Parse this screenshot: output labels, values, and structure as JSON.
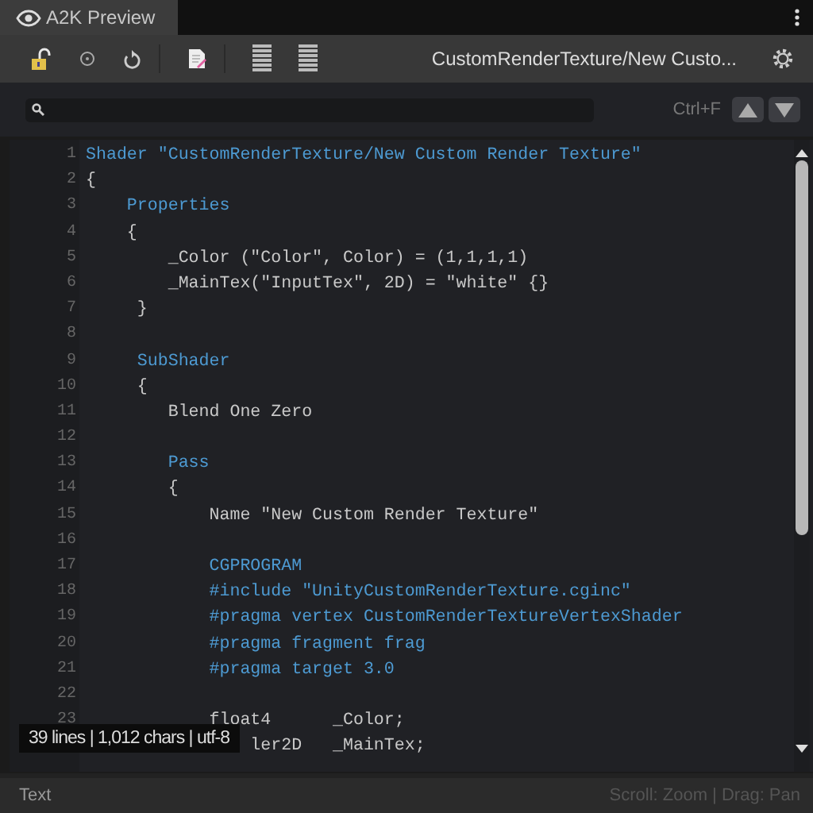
{
  "tab": {
    "label": "A2K Preview",
    "selected": true
  },
  "toolbar": {
    "title": "CustomRenderTexture/New Custo..."
  },
  "search": {
    "shortcut": "Ctrl+F"
  },
  "code": {
    "lines": [
      {
        "number": "1",
        "kind": "keyword",
        "text": "Shader \"CustomRenderTexture/New Custom Render Texture\""
      },
      {
        "number": "2",
        "kind": "plain",
        "text": "{"
      },
      {
        "number": "3",
        "kind": "keyword",
        "text": "    Properties"
      },
      {
        "number": "4",
        "kind": "plain",
        "text": "    {"
      },
      {
        "number": "5",
        "kind": "plain",
        "text": "        _Color (\"Color\", Color) = (1,1,1,1)"
      },
      {
        "number": "6",
        "kind": "plain",
        "text": "        _MainTex(\"InputTex\", 2D) = \"white\" {}"
      },
      {
        "number": "7",
        "kind": "plain",
        "text": "     }"
      },
      {
        "number": "8"
      },
      {
        "number": "9",
        "kind": "keyword",
        "text": "     SubShader"
      },
      {
        "number": "10",
        "kind": "plain",
        "text": "     {"
      },
      {
        "number": "11",
        "kind": "plain",
        "text": "        Blend One Zero"
      },
      {
        "number": "12"
      },
      {
        "number": "13",
        "kind": "keyword",
        "text": "        Pass"
      },
      {
        "number": "14",
        "kind": "plain",
        "text": "        {"
      },
      {
        "number": "15",
        "kind": "plain",
        "text": "            Name \"New Custom Render Texture\""
      },
      {
        "number": "16"
      },
      {
        "number": "17",
        "kind": "keyword",
        "text": "            CGPROGRAM"
      },
      {
        "number": "18",
        "kind": "keyword",
        "text": "            #include \"UnityCustomRenderTexture.cginc\""
      },
      {
        "number": "19",
        "kind": "keyword",
        "text": "            #pragma vertex CustomRenderTextureVertexShader"
      },
      {
        "number": "20",
        "kind": "keyword",
        "text": "            #pragma fragment frag"
      },
      {
        "number": "21",
        "kind": "keyword",
        "text": "            #pragma target 3.0"
      },
      {
        "number": "22"
      },
      {
        "number": "23",
        "kind": "plain",
        "text": "            float4      _Color;"
      },
      {
        "kind": "plain",
        "text": "                ler2D   _MainTex;"
      }
    ]
  },
  "info_overlay": "39 lines | 1,012 chars | utf-8",
  "status_bar": {
    "left": "Text",
    "right": "Scroll: Zoom | Drag: Pan"
  }
}
